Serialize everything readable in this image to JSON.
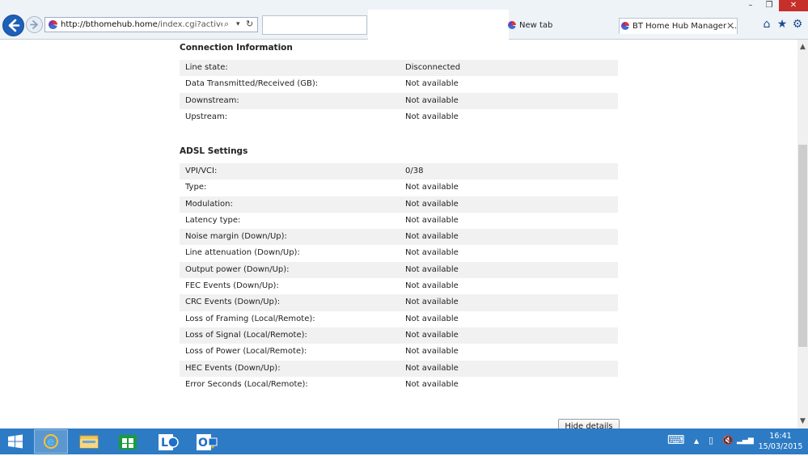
{
  "browser": {
    "url_host": "http://bthomehub.home",
    "url_path": "/index.cgi?active_page=",
    "search_glyph": "⌕",
    "dropdown_glyph": "▾",
    "refresh_glyph": "↻",
    "tabs": [
      {
        "label": "New tab"
      },
      {
        "label": "BT Home Hub Manager -..."
      }
    ],
    "close_glyph": "✕",
    "window_controls": {
      "minimize": "–",
      "maximize": "❐",
      "close": "✕"
    },
    "toolbar_icons": {
      "home": "⌂",
      "favorites": "★",
      "tools": "⚙"
    }
  },
  "connection": {
    "title": "Connection Information",
    "rows": [
      {
        "label": "Line state:",
        "value": "Disconnected"
      },
      {
        "label": "Data Transmitted/Received (GB):",
        "value": "Not available"
      },
      {
        "label": "Downstream:",
        "value": "Not available"
      },
      {
        "label": "Upstream:",
        "value": "Not available"
      }
    ]
  },
  "adsl": {
    "title": "ADSL Settings",
    "rows": [
      {
        "label": "VPI/VCI:",
        "value": "0/38"
      },
      {
        "label": "Type:",
        "value": "Not available"
      },
      {
        "label": "Modulation:",
        "value": "Not available"
      },
      {
        "label": "Latency type:",
        "value": "Not available"
      },
      {
        "label": "Noise margin (Down/Up):",
        "value": "Not available"
      },
      {
        "label": "Line attenuation (Down/Up):",
        "value": "Not available"
      },
      {
        "label": "Output power (Down/Up):",
        "value": "Not available"
      },
      {
        "label": "FEC Events (Down/Up):",
        "value": "Not available"
      },
      {
        "label": "CRC Events (Down/Up):",
        "value": "Not available"
      },
      {
        "label": "Loss of Framing (Local/Remote):",
        "value": "Not available"
      },
      {
        "label": "Loss of Signal (Local/Remote):",
        "value": "Not available"
      },
      {
        "label": "Loss of Power (Local/Remote):",
        "value": "Not available"
      },
      {
        "label": "HEC Events (Down/Up):",
        "value": "Not available"
      },
      {
        "label": "Error Seconds (Local/Remote):",
        "value": "Not available"
      }
    ]
  },
  "hide_details_label": "Hide details",
  "scrollbar": {
    "up": "▲",
    "down": "▼"
  },
  "taskbar": {
    "time": "16:41",
    "date": "15/03/2015",
    "tray_icons": {
      "keyboard": "⌨",
      "chevron": "▲",
      "power": "▯",
      "volume": "🔇",
      "network": "▂▄▆"
    }
  },
  "colors": {
    "taskbar": "#2d7bc4",
    "back_button": "#1e5fb8",
    "row_alt": "#f1f1f1",
    "close_button": "#c7302a"
  }
}
